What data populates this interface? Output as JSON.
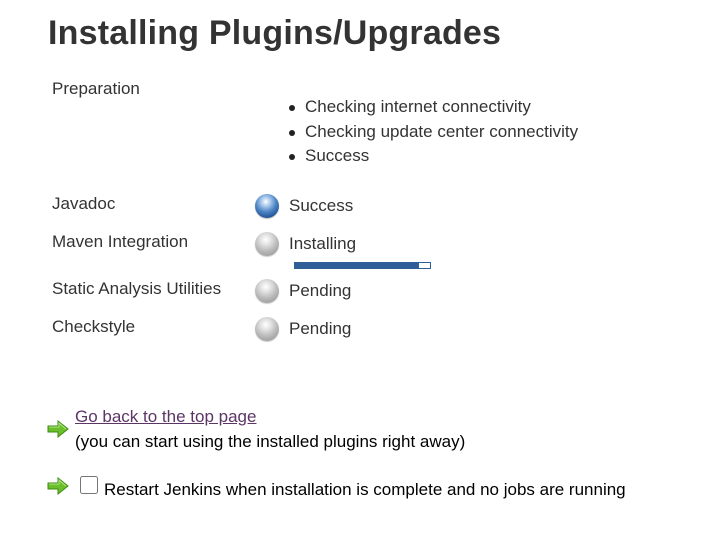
{
  "page": {
    "title": "Installing Plugins/Upgrades"
  },
  "preparation": {
    "label": "Preparation",
    "items": [
      "Checking internet connectivity",
      "Checking update center connectivity",
      "Success"
    ]
  },
  "plugins": [
    {
      "name": "Javadoc",
      "status": "Success",
      "icon": "blue-ball-icon"
    },
    {
      "name": "Maven Integration",
      "status": "Installing",
      "icon": "grey-ball-icon",
      "progress_fraction": 0.92
    },
    {
      "name": "Static Analysis Utilities",
      "status": "Pending",
      "icon": "grey-ball-icon"
    },
    {
      "name": "Checkstyle",
      "status": "Pending",
      "icon": "grey-ball-icon"
    }
  ],
  "actions": {
    "back_link": "Go back to the top page",
    "back_note": "(you can start using the installed plugins right away)",
    "restart_label": "Restart Jenkins when installation is complete and no jobs are running",
    "restart_checked": false,
    "arrow_icon": "green-arrow-icon"
  },
  "colors": {
    "success_ball": "#4f86c6",
    "pending_ball": "#bdbdbd",
    "progress_bar": "#2f5e98",
    "link": "#5c3566",
    "arrow": "#6abf2a"
  }
}
